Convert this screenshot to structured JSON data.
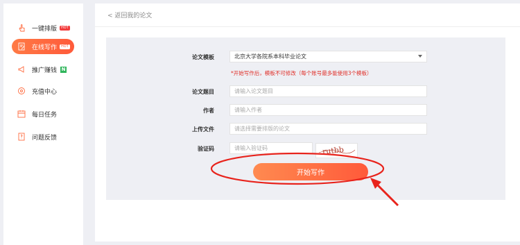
{
  "sidebar": {
    "items": [
      {
        "label": "一键排版",
        "icon": "hand-pointer-icon",
        "badge": "HOT",
        "active": false
      },
      {
        "label": "在线写作",
        "icon": "document-edit-icon",
        "badge": "HOT",
        "active": true
      },
      {
        "label": "推广赚钱",
        "icon": "megaphone-icon",
        "badge": "N",
        "active": false
      },
      {
        "label": "充值中心",
        "icon": "target-icon",
        "badge": "",
        "active": false
      },
      {
        "label": "每日任务",
        "icon": "calendar-icon",
        "badge": "",
        "active": false
      },
      {
        "label": "问题反馈",
        "icon": "feedback-icon",
        "badge": "",
        "active": false
      }
    ]
  },
  "header": {
    "back_label": "< 返回我的论文"
  },
  "form": {
    "template_label": "论文模板",
    "template_value": "北京大学各院系本科毕业论文",
    "template_warning": "*开始写作后，模板不可修改（每个账号最多能使用3个模板）",
    "title_label": "论文题目",
    "title_placeholder": "请输入论文题目",
    "author_label": "作者",
    "author_placeholder": "请输入作者",
    "upload_label": "上传文件",
    "upload_placeholder": "请选择需要排版的论文",
    "captcha_label": "验证码",
    "captcha_placeholder": "请输入验证码",
    "captcha_text": "rutbb",
    "submit_label": "开始写作"
  },
  "colors": {
    "accent": "#ff6a3d",
    "annotation": "#e8231c"
  }
}
